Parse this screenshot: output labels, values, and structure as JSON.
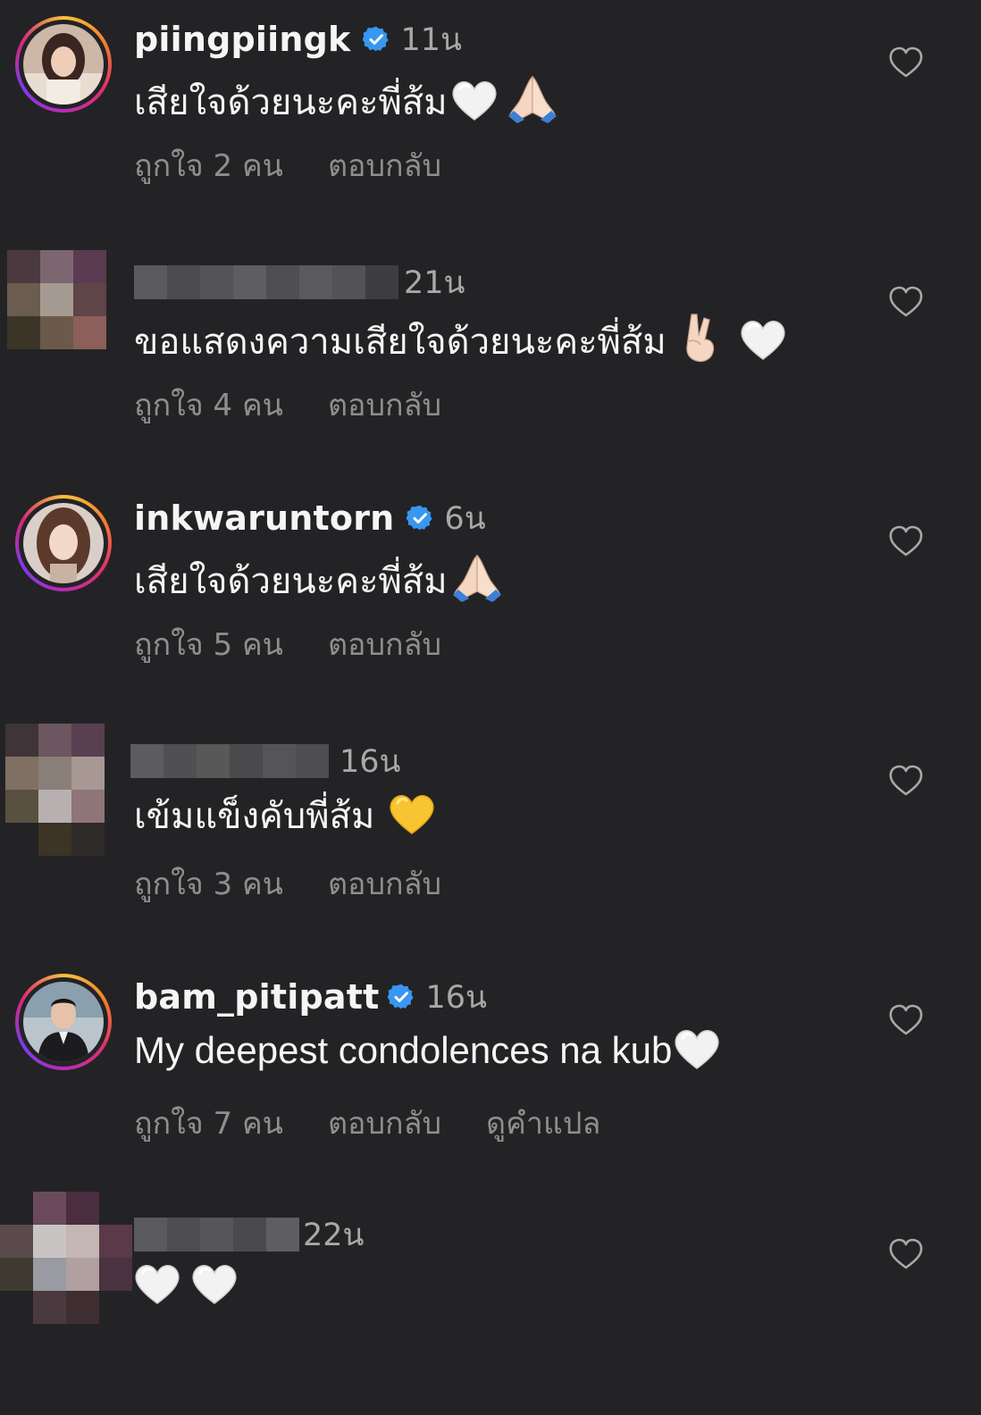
{
  "comments": [
    {
      "username": "piingpiingk",
      "verified": true,
      "time": "11น",
      "text": "เสียใจด้วยนะคะพี่ส้ม",
      "likes": "ถูกใจ 2 คน",
      "reply": "ตอบกลับ",
      "emojis": [
        "white-heart",
        "folded-hands"
      ]
    },
    {
      "username": "",
      "verified": false,
      "time": "21น",
      "text": "ขอแสดงความเสียใจด้วยนะคะพี่ส้ม",
      "likes": "ถูกใจ 4 คน",
      "reply": "ตอบกลับ",
      "emojis": [
        "victory-hand",
        "white-heart"
      ]
    },
    {
      "username": "inkwaruntorn",
      "verified": true,
      "time": "6น",
      "text": "เสียใจด้วยนะคะพี่ส้ม",
      "likes": "ถูกใจ 5 คน",
      "reply": "ตอบกลับ",
      "emojis": [
        "folded-hands"
      ]
    },
    {
      "username": "",
      "verified": false,
      "time": "16น",
      "text": "เข้มแข็งคับพี่ส้ม",
      "likes": "ถูกใจ 3 คน",
      "reply": "ตอบกลับ",
      "emojis": [
        "yellow-heart"
      ]
    },
    {
      "username": "bam_pitipatt",
      "verified": true,
      "time": "16น",
      "text": "My deepest condolences na kub",
      "likes": "ถูกใจ 7 คน",
      "reply": "ตอบกลับ",
      "translate": "ดูคำแปล",
      "emojis": [
        "white-heart"
      ]
    },
    {
      "username": "",
      "verified": false,
      "time": "22น",
      "text": "",
      "emojis": [
        "white-heart",
        "white-heart"
      ]
    }
  ],
  "icons": {
    "like": "heart-outline-icon",
    "verified": "verified-badge-icon"
  },
  "colors": {
    "background": "#232325",
    "primary_text": "#f5f5f5",
    "secondary_text": "#8e8e8e",
    "verified_blue": "#3897f0"
  }
}
